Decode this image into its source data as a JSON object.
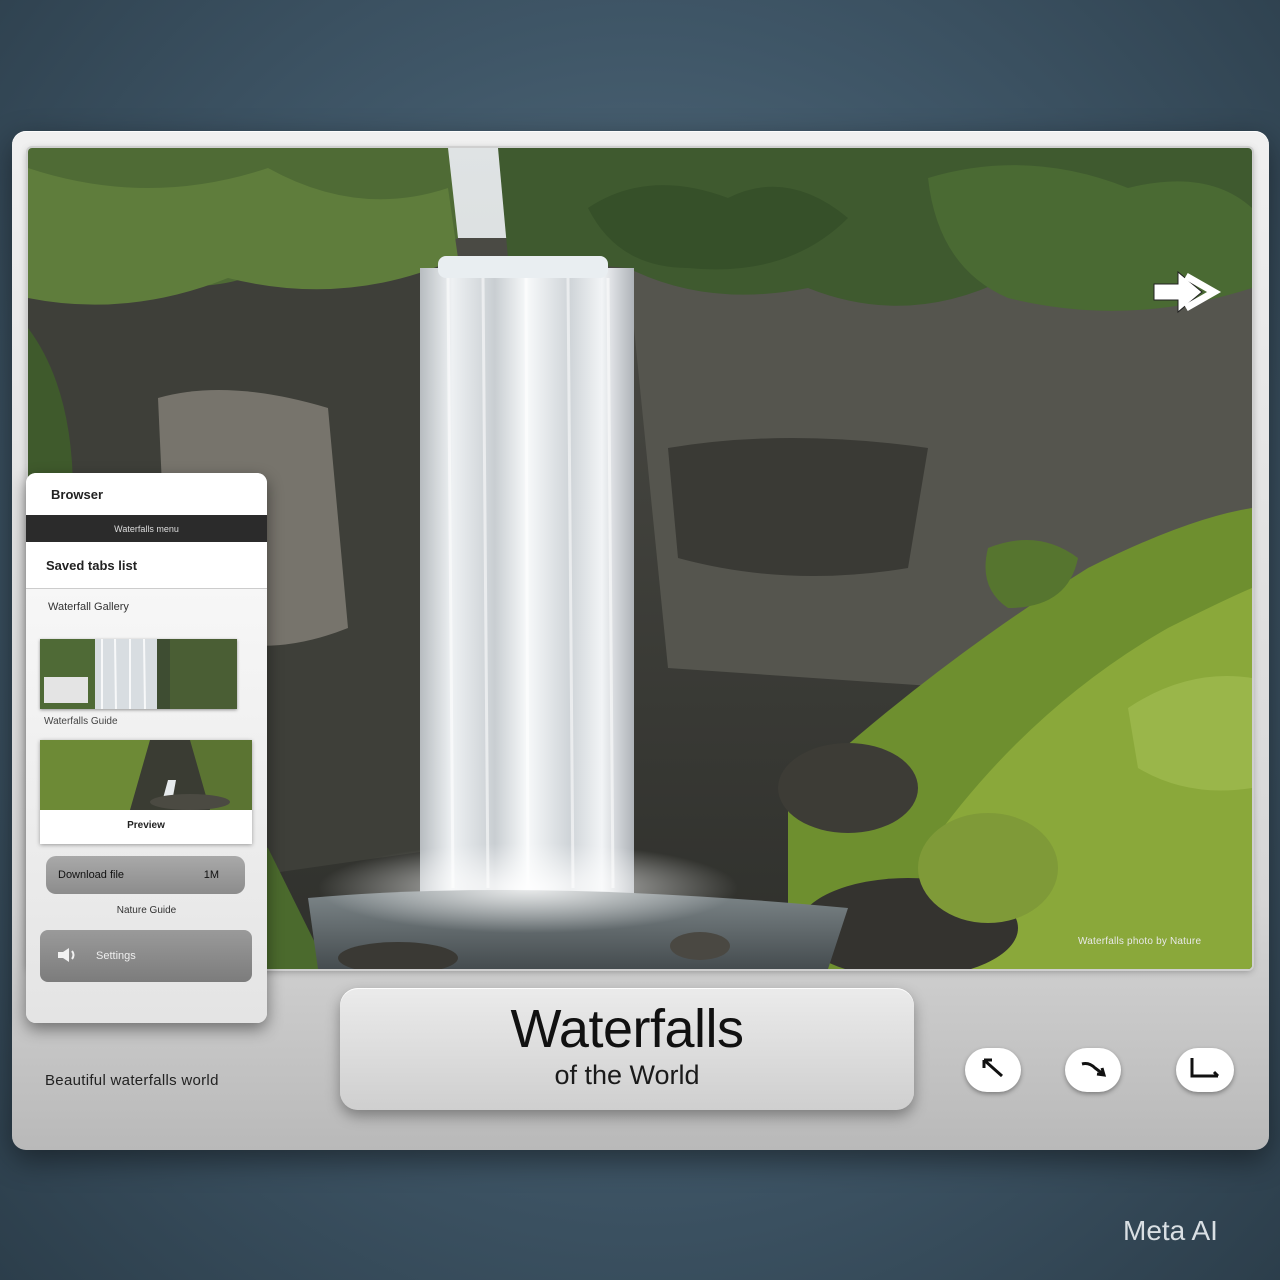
{
  "sidebar": {
    "header": "Browser",
    "bar_text": "Waterfalls menu",
    "section_label": "Saved tabs list",
    "list_title": "Waterfall Gallery",
    "thumb1_caption": "Waterfalls Guide",
    "thumb2_caption": "Preview",
    "pill_label": "Download file",
    "pill_badge": "1M",
    "sublabel": "Nature Guide",
    "audio_label": "Settings"
  },
  "hero": {
    "photo_credit": "Waterfalls photo by Nature"
  },
  "status": {
    "text": "Beautiful waterfalls world"
  },
  "title_card": {
    "title": "Waterfalls",
    "subtitle": "of the World"
  },
  "watermark": "Meta AI",
  "icons": {
    "next": "double-arrow-right-icon",
    "zoom": "diagonal-arrow-icon",
    "rotate": "curve-arrow-icon",
    "crop": "corner-crop-icon"
  }
}
